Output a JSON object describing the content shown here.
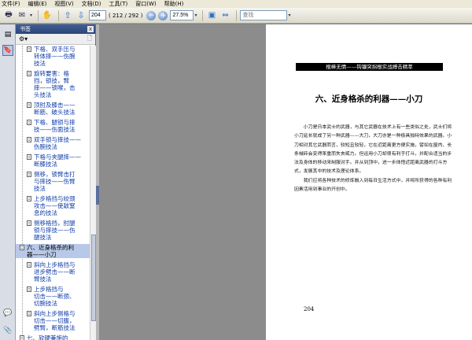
{
  "menu": [
    "文件(F)",
    "编辑(E)",
    "视图(V)",
    "文档(D)",
    "工具(T)",
    "窗口(W)",
    "帮助(H)"
  ],
  "toolbar": {
    "current_page": "204",
    "page_count": "( 212 / 292 )",
    "zoom": "27.5%",
    "search_placeholder": "查找"
  },
  "bookmarks": {
    "header": "书签",
    "close_label": "x",
    "items": [
      {
        "text": "下格、双手压与\n转体摔——伤腕\n技法"
      },
      {
        "text": "旋转要害：格\n挡，锁技，臂\n摔——锁喉，击\n头技法"
      },
      {
        "text": "顶肘及膝击——\n断筋、破头技法"
      },
      {
        "text": "下格、腿锁与摔\n技——伤面技法"
      },
      {
        "text": "双手锁与摔技——\n伤腕技法"
      },
      {
        "text": "下格与夹腿摔——\n断膝技法"
      },
      {
        "text": "侧移，锁臂击打\n与摔技——伤臂\n技法"
      },
      {
        "text": "上步格挡与绞颈\n攻击——使敌窒\n息的技法"
      },
      {
        "text": "侧移格挡，肘腿\n锁与摔技——伤\n腿技法"
      },
      {
        "text": "六、近身格杀的利\n器——小刀",
        "top": true,
        "active": true
      },
      {
        "text": "斜向上步格挡与\n进步劈击——断\n臂技法"
      },
      {
        "text": "上步格挡与\n切击——断颈、\n切腕技法"
      },
      {
        "text": "斜向上步侧格与\n切击——切腹，\n劈臂，断筋技法"
      },
      {
        "text": "七、软硬兼施的\n便携器械——九\n节鞭",
        "top": true
      }
    ]
  },
  "page": {
    "running_head": "棍棒无情——钩镰突拐棍实战搏击精萃",
    "chapter_title": "六、近身格杀的利器——小刀",
    "paragraphs": [
      "小刀是日本武士的武器，与其它武器在技术上有一些类似之处，武士们将小刀延长就成了另一种武器——大刀，大刀亦是一种极具独特效果的武器。小刀相对其它武器而言，较短且较轻，它在近距离更方便实施，譬如在屋内、长条械砖会变得笨重而失去威力。但运用小刀却很有利于打斗，并配合适当的步法及身体的移动来制服对手。并从到顶中，进一步体悟近距离武器的打斗方式，发展其中的技术及理论体系。",
      "我们应将各种技术的修炼融入到每日生活方式中，并将所获得的各种有利因素活用到事业的开创中。"
    ],
    "page_number": "204"
  }
}
